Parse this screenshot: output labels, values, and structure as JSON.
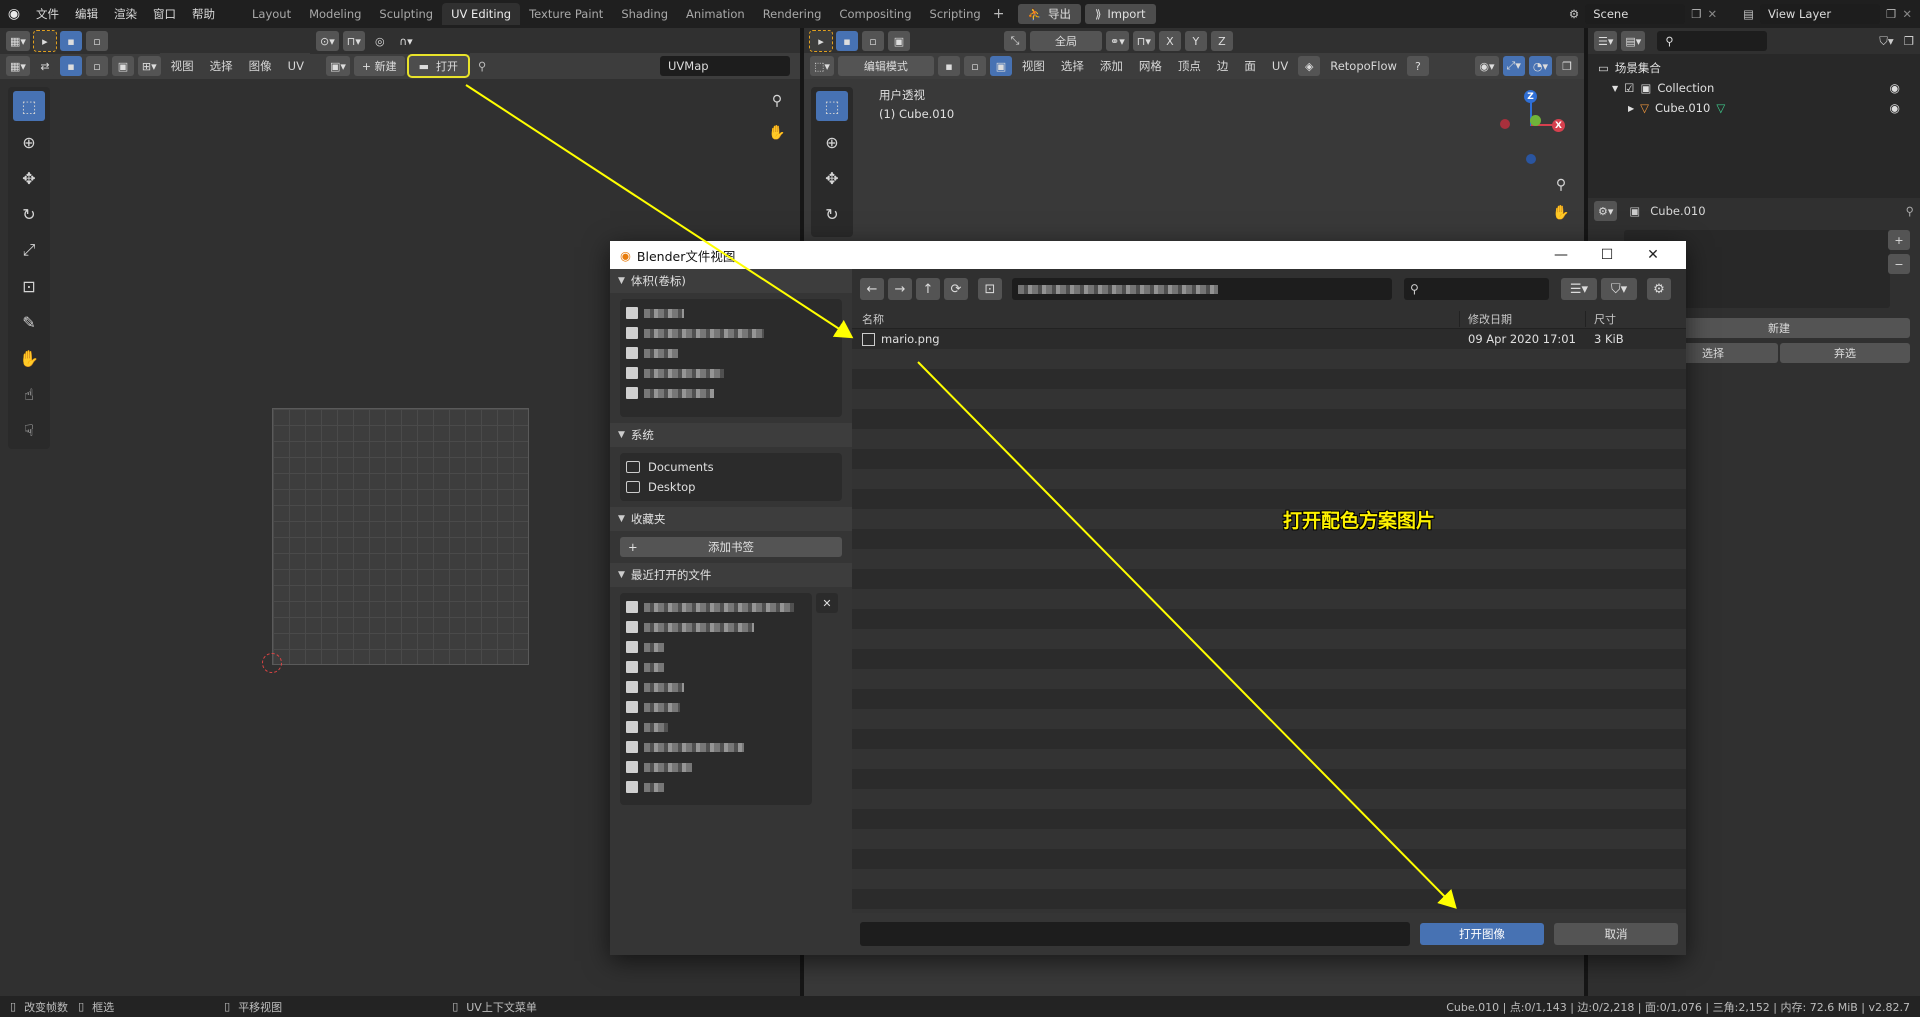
{
  "topbar": {
    "menu": [
      "文件",
      "编辑",
      "渲染",
      "窗口",
      "帮助"
    ],
    "workspaces": [
      "Layout",
      "Modeling",
      "Sculpting",
      "UV Editing",
      "Texture Paint",
      "Shading",
      "Animation",
      "Rendering",
      "Compositing",
      "Scripting"
    ],
    "active_workspace": "UV Editing",
    "export_label": "导出",
    "import_label": "Import",
    "scene": "Scene",
    "view_layer": "View Layer"
  },
  "uv_editor": {
    "menu": [
      "视图",
      "选择",
      "图像",
      "UV"
    ],
    "new_label": "新建",
    "open_label": "打开",
    "uvmap": "UVMap"
  },
  "viewport": {
    "mode": "编辑模式",
    "menu": [
      "视图",
      "选择",
      "添加",
      "网格",
      "顶点",
      "边",
      "面",
      "UV"
    ],
    "retopoflow": "RetopoFlow",
    "orientation": "全局",
    "view_name": "用户透视",
    "object_name": "(1) Cube.010",
    "axis_x": "X",
    "axis_y": "Y",
    "axis_z": "Z"
  },
  "outliner": {
    "root": "场景集合",
    "collection": "Collection",
    "object": "Cube.010"
  },
  "properties": {
    "object": "Cube.010",
    "new_label": "新建",
    "select_label": "选择",
    "deselect_label": "弃选"
  },
  "dialog": {
    "title": "Blender文件视图",
    "volumes_header": "体积(卷标)",
    "system_header": "系统",
    "system_items": [
      "Documents",
      "Desktop"
    ],
    "bookmarks_header": "收藏夹",
    "add_bookmark": "添加书签",
    "recent_header": "最近打开的文件",
    "col_name": "名称",
    "col_date": "修改日期",
    "col_size": "尺寸",
    "files": [
      {
        "name": "mario.png",
        "date": "09 Apr 2020 17:01",
        "size": "3 KiB"
      }
    ],
    "open_button": "打开图像",
    "cancel_button": "取消"
  },
  "annotation": {
    "text": "打开配色方案图片",
    "color": "#fff200"
  },
  "statusbar": {
    "left": [
      "改变帧数",
      "框选",
      "平移视图",
      "UV上下文菜单"
    ],
    "right": "Cube.010 | 点:0/1,143 | 边:0/2,218 | 面:0/1,076 | 三角:2,152 | 内存: 72.6 MiB | v2.82.7"
  },
  "colors": {
    "accent": "#4772b3",
    "background": "#303030",
    "arrow": "#ffff00"
  }
}
